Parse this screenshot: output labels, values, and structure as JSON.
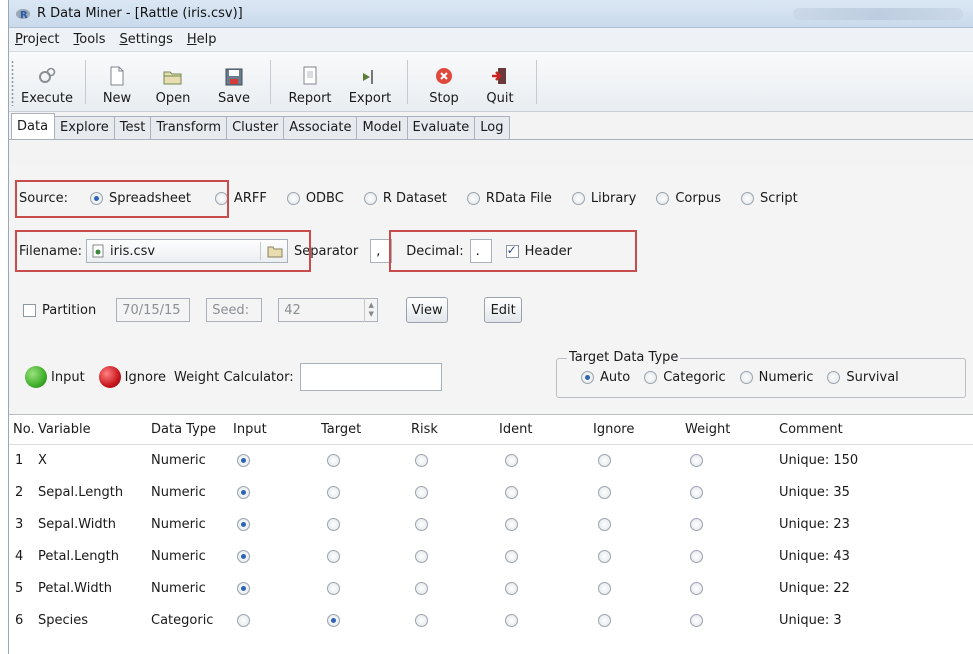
{
  "window": {
    "title": "R Data Miner - [Rattle (iris.csv)]"
  },
  "menu": [
    "Project",
    "Tools",
    "Settings",
    "Help"
  ],
  "toolbar": [
    {
      "label": "Execute",
      "icon": "execute-icon"
    },
    {
      "label": "New",
      "icon": "new-icon"
    },
    {
      "label": "Open",
      "icon": "open-icon"
    },
    {
      "label": "Save",
      "icon": "save-icon"
    },
    {
      "label": "Report",
      "icon": "report-icon"
    },
    {
      "label": "Export",
      "icon": "export-icon"
    },
    {
      "label": "Stop",
      "icon": "stop-icon"
    },
    {
      "label": "Quit",
      "icon": "quit-icon"
    }
  ],
  "tabs": [
    "Data",
    "Explore",
    "Test",
    "Transform",
    "Cluster",
    "Associate",
    "Model",
    "Evaluate",
    "Log"
  ],
  "source": {
    "label": "Source:",
    "options": [
      "Spreadsheet",
      "ARFF",
      "ODBC",
      "R Dataset",
      "RData File",
      "Library",
      "Corpus",
      "Script"
    ],
    "selected": "Spreadsheet"
  },
  "file": {
    "filename_label": "Filename:",
    "filename": "iris.csv",
    "separator_label": "Separator",
    "separator": ",",
    "decimal_label": "Decimal:",
    "decimal": ".",
    "header_label": "Header",
    "header_checked": true
  },
  "partition": {
    "label": "Partition",
    "value": "70/15/15",
    "seed_label": "Seed:",
    "seed": "42",
    "view_label": "View",
    "edit_label": "Edit"
  },
  "roles": {
    "input_label": "Input",
    "ignore_label": "Ignore",
    "weight_label": "Weight Calculator:",
    "weight_value": ""
  },
  "target_type": {
    "title": "Target Data Type",
    "options": [
      "Auto",
      "Categoric",
      "Numeric",
      "Survival"
    ],
    "selected": "Auto"
  },
  "table": {
    "headers": [
      "No.",
      "Variable",
      "Data Type",
      "Input",
      "Target",
      "Risk",
      "Ident",
      "Ignore",
      "Weight",
      "Comment"
    ],
    "rows": [
      {
        "no": "1",
        "variable": "X",
        "type": "Numeric",
        "role": "Input",
        "comment": "Unique: 150"
      },
      {
        "no": "2",
        "variable": "Sepal.Length",
        "type": "Numeric",
        "role": "Input",
        "comment": "Unique: 35"
      },
      {
        "no": "3",
        "variable": "Sepal.Width",
        "type": "Numeric",
        "role": "Input",
        "comment": "Unique: 23"
      },
      {
        "no": "4",
        "variable": "Petal.Length",
        "type": "Numeric",
        "role": "Input",
        "comment": "Unique: 43"
      },
      {
        "no": "5",
        "variable": "Petal.Width",
        "type": "Numeric",
        "role": "Input",
        "comment": "Unique: 22"
      },
      {
        "no": "6",
        "variable": "Species",
        "type": "Categoric",
        "role": "Target",
        "comment": "Unique: 3"
      }
    ]
  },
  "colors": {
    "highlight": "#c94c4c",
    "input_green": "#3fae2a",
    "ignore_red": "#c8161d",
    "radio_selected": "#2d64b5"
  }
}
